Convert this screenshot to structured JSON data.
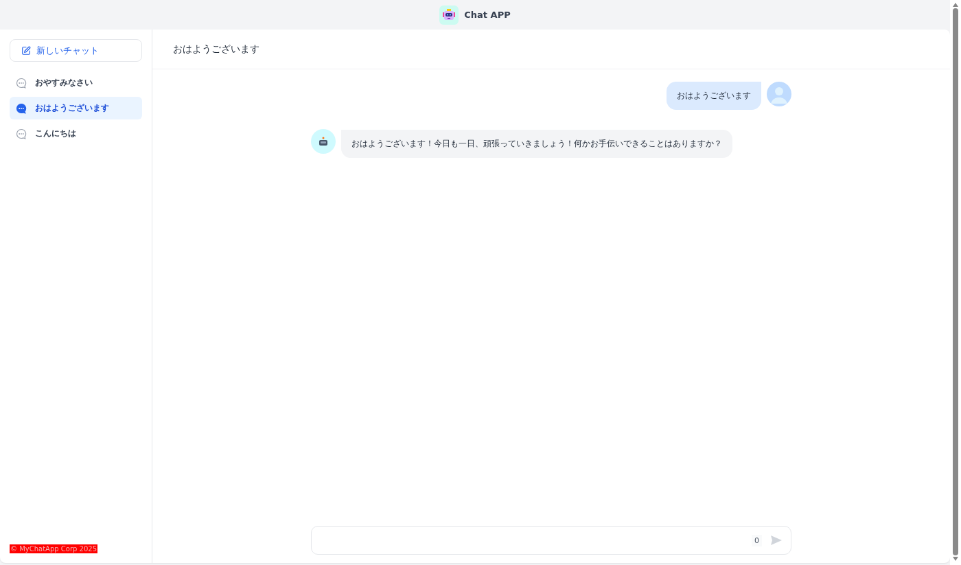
{
  "app": {
    "title": "Chat APP"
  },
  "sidebar": {
    "new_chat": "新しいチャット",
    "items": [
      {
        "label": "おやすみなさい",
        "selected": false
      },
      {
        "label": "おはようございます",
        "selected": true
      },
      {
        "label": "こんにちは",
        "selected": false
      }
    ],
    "footer": "© MyChatApp Corp 2025"
  },
  "chat": {
    "title": "おはようございます",
    "messages": [
      {
        "kind": "user",
        "text": "おはようございます"
      },
      {
        "kind": "bot",
        "text": "おはようございます！今日も一日、頑張っていきましょう！何かお手伝いできることはありますか？"
      }
    ]
  },
  "input": {
    "counter": "0"
  }
}
